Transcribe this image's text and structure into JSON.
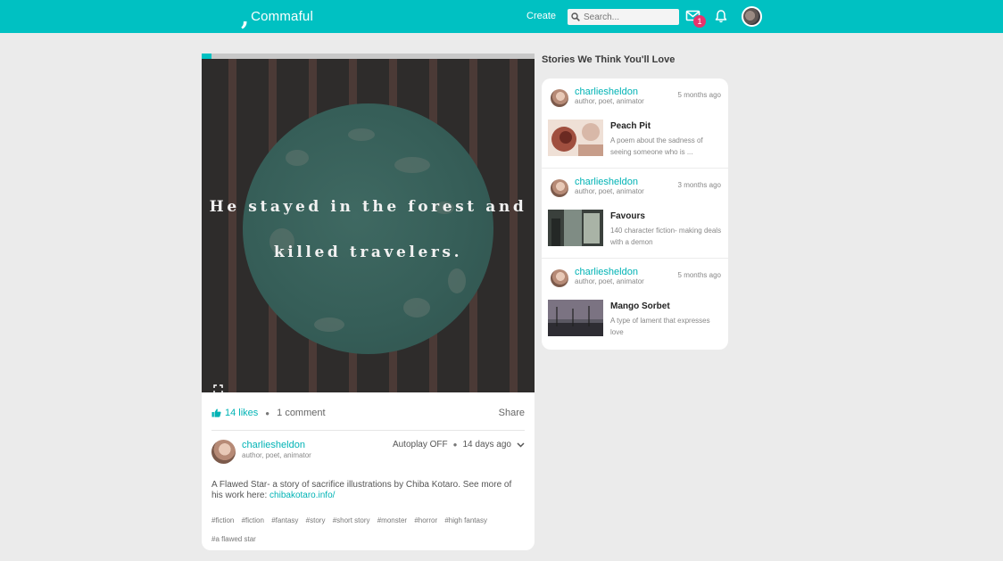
{
  "topbar": {
    "logo_text": "Commaful",
    "create_label": "Create",
    "search_placeholder": "Search...",
    "mail_badge": "1"
  },
  "post": {
    "progress_fraction": 0.03,
    "art_line_1": "He stayed in the forest and",
    "art_line_2": "killed travelers.",
    "likes_label": "14 likes",
    "comments_label": "1 comment",
    "share_label": "Share",
    "author_name": "charliesheldon",
    "author_role": "author, poet, animator",
    "autoplay_label": "Autoplay OFF",
    "posted_time": "14 days ago",
    "description": "A Flawed Star- a story of sacrifice illustrations by Chiba Kotaro. See more of his work here: ",
    "description_link": "chibakotaro.info/",
    "tags": [
      "#fiction",
      "#fiction",
      "#fantasy",
      "#story",
      "#short story",
      "#monster",
      "#horror",
      "#high fantasy",
      "#a flawed star"
    ]
  },
  "sidebar": {
    "title": "Stories We Think You'll Love",
    "items": [
      {
        "author": "charliesheldon",
        "role": "author, poet, animator",
        "time": "5 months ago",
        "title": "Peach Pit",
        "desc": "A poem about the sadness of seeing someone who is ..."
      },
      {
        "author": "charliesheldon",
        "role": "author, poet, animator",
        "time": "3 months ago",
        "title": "Favours",
        "desc": "140 character fiction- making deals with a demon"
      },
      {
        "author": "charliesheldon",
        "role": "author, poet, animator",
        "time": "5 months ago",
        "title": "Mango Sorbet",
        "desc": "A type of lament that expresses love"
      }
    ]
  },
  "colors": {
    "brand": "#00c1c2",
    "link": "#00b3b5",
    "badge": "#e8336c"
  },
  "icons": [
    "comma-logo-icon",
    "search-icon",
    "mail-icon",
    "bell-icon",
    "expand-icon",
    "thumbs-up-icon",
    "chevron-down-icon"
  ]
}
